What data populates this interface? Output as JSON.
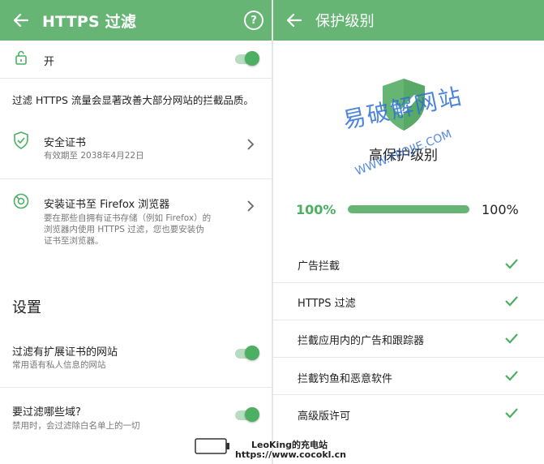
{
  "left": {
    "title": "HTTPS 过滤",
    "help_symbol": "?",
    "toggle_on_label": "开",
    "toggle_on": true,
    "description": "过滤 HTTPS 流量会显著改善大部分网站的拦截品质。",
    "cert": {
      "title": "安全证书",
      "subtitle": "有效期至 2038年4月22日"
    },
    "firefox": {
      "title": "安装证书至 Firefox 浏览器",
      "desc_lines": [
        "要在那些自拥有证书存储（例如 Firefox）的",
        "浏览器内使用 HTTPS 过滤，您也要安装伪",
        "证书至浏览器。"
      ]
    },
    "section_title": "设置",
    "settings": [
      {
        "title": "过滤有扩展证书的网站",
        "subtitle": "常用语有私人信息的网站",
        "on": true
      },
      {
        "title": "要过滤哪些域?",
        "subtitle": "禁用时，会过滤除白名单上的一切",
        "on": true
      }
    ]
  },
  "right": {
    "title": "保护级别",
    "level_label": "高保护级别",
    "progress_left": "100%",
    "progress_right": "100%",
    "progress_value": 1.0,
    "features": [
      "广告拦截",
      "HTTPS 过滤",
      "拦截应用内的广告和跟踪器",
      "拦截钓鱼和恶意软件",
      "高级版许可"
    ]
  },
  "watermark": {
    "cn_text": "易破解网站",
    "url_text": "WWW.YPOJIE.COM"
  },
  "footer": {
    "line1": "LeoKing的充电站",
    "line2": "https://www.cocokl.cn"
  },
  "colors": {
    "accent": "#66b574",
    "toggle_knob": "#4caf62",
    "progress_text": "#4caf62",
    "watermark": "#2f6fd6"
  }
}
